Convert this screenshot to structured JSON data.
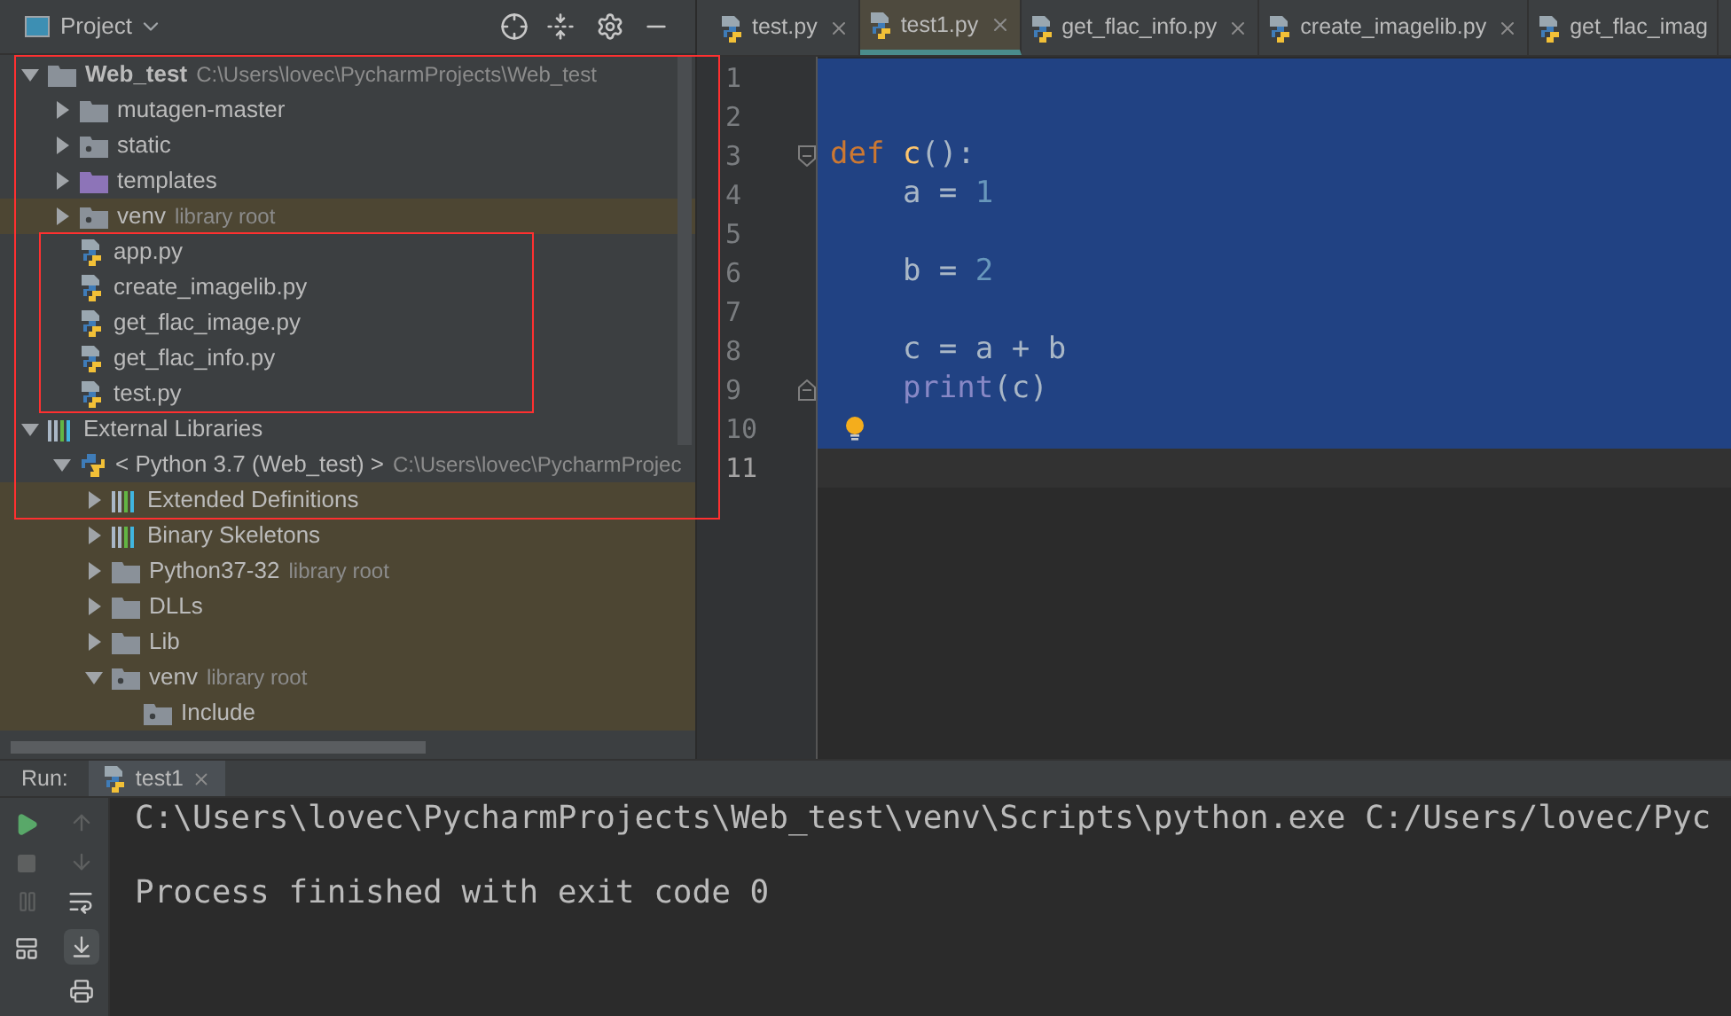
{
  "project_panel": {
    "title": "Project",
    "tree": [
      {
        "label": "Web_test",
        "hint": "C:\\Users\\lovec\\PycharmProjects\\Web_test",
        "kind": "project",
        "expanded": true,
        "highlighted": false,
        "children": [
          {
            "label": "mutagen-master",
            "kind": "folder",
            "expanded": false,
            "highlighted": false
          },
          {
            "label": "static",
            "kind": "module-folder",
            "expanded": false,
            "highlighted": false
          },
          {
            "label": "templates",
            "kind": "template-folder",
            "expanded": false,
            "highlighted": false
          },
          {
            "label": "venv",
            "hint": "library root",
            "kind": "module-folder",
            "expanded": false,
            "highlighted": true
          },
          {
            "label": "app.py",
            "kind": "python-file",
            "highlighted": false
          },
          {
            "label": "create_imagelib.py",
            "kind": "python-file",
            "highlighted": false
          },
          {
            "label": "get_flac_image.py",
            "kind": "python-file",
            "highlighted": false
          },
          {
            "label": "get_flac_info.py",
            "kind": "python-file",
            "highlighted": false
          },
          {
            "label": "test.py",
            "kind": "python-file",
            "highlighted": false
          }
        ]
      },
      {
        "label": "External Libraries",
        "kind": "library",
        "expanded": true,
        "highlighted": false,
        "children": [
          {
            "label": "< Python 3.7 (Web_test) >",
            "hint": "C:\\Users\\lovec\\PycharmProjec",
            "kind": "python-sdk",
            "expanded": true,
            "highlighted": false,
            "children": [
              {
                "label": "Extended Definitions",
                "kind": "library",
                "expanded": false,
                "highlighted": true
              },
              {
                "label": "Binary Skeletons",
                "kind": "library",
                "expanded": false,
                "highlighted": true
              },
              {
                "label": "Python37-32",
                "hint": "library root",
                "kind": "folder",
                "expanded": false,
                "highlighted": true
              },
              {
                "label": "DLLs",
                "kind": "folder",
                "expanded": false,
                "highlighted": true
              },
              {
                "label": "Lib",
                "kind": "folder",
                "expanded": false,
                "highlighted": true
              },
              {
                "label": "venv",
                "hint": "library root",
                "kind": "module-folder",
                "expanded": true,
                "highlighted": true,
                "children": [
                  {
                    "label": "Include",
                    "kind": "module-folder",
                    "highlighted": true
                  }
                ]
              }
            ]
          }
        ]
      }
    ]
  },
  "editor": {
    "tabs": [
      {
        "label": "test.py",
        "selected": false,
        "closable": true
      },
      {
        "label": "test1.py",
        "selected": true,
        "closable": true
      },
      {
        "label": "get_flac_info.py",
        "selected": false,
        "closable": true
      },
      {
        "label": "create_imagelib.py",
        "selected": false,
        "closable": true
      },
      {
        "label": "get_flac_imag",
        "selected": false,
        "closable": false
      }
    ],
    "lines": [
      {
        "number": "1",
        "selected": true,
        "current": false
      },
      {
        "number": "2",
        "selected": true,
        "current": false
      },
      {
        "number": "3",
        "selected": true,
        "current": false,
        "fold_start": true,
        "tokens": [
          {
            "kind": "keyword",
            "text": "def "
          },
          {
            "kind": "function",
            "text": "c"
          },
          {
            "kind": "plain",
            "text": "():"
          }
        ]
      },
      {
        "number": "4",
        "selected": true,
        "current": false,
        "tokens": [
          {
            "kind": "plain",
            "text": "    a = "
          },
          {
            "kind": "number",
            "text": "1"
          }
        ]
      },
      {
        "number": "5",
        "selected": true,
        "current": false
      },
      {
        "number": "6",
        "selected": true,
        "current": false,
        "tokens": [
          {
            "kind": "plain",
            "text": "    b = "
          },
          {
            "kind": "number",
            "text": "2"
          }
        ]
      },
      {
        "number": "7",
        "selected": true,
        "current": false
      },
      {
        "number": "8",
        "selected": true,
        "current": false,
        "tokens": [
          {
            "kind": "plain",
            "text": "    c = a + b"
          }
        ]
      },
      {
        "number": "9",
        "selected": true,
        "current": false,
        "fold_end": true,
        "tokens": [
          {
            "kind": "builtin",
            "text": "    print"
          },
          {
            "kind": "plain",
            "text": "(c)"
          }
        ]
      },
      {
        "number": "10",
        "selected": true,
        "current": false,
        "bulb": true
      },
      {
        "number": "11",
        "selected": false,
        "current": true
      }
    ]
  },
  "run_panel": {
    "label": "Run:",
    "tabs": [
      {
        "label": "test1",
        "selected": true
      }
    ],
    "output": [
      "C:\\Users\\lovec\\PycharmProjects\\Web_test\\venv\\Scripts\\python.exe C:/Users/lovec/Pyc",
      "Process finished with exit code 0"
    ]
  }
}
